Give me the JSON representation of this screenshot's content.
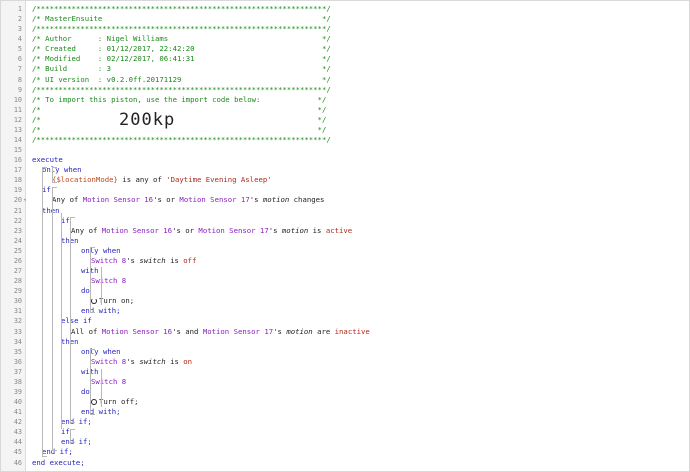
{
  "lines": [
    {
      "n": "1",
      "t": "/******************************************************************/"
    },
    {
      "n": "2",
      "t": "/* MasterEnsuite                                                  */"
    },
    {
      "n": "3",
      "t": "/******************************************************************/"
    },
    {
      "n": "4",
      "t": "/* Author      : Nigel Williams                                   */"
    },
    {
      "n": "5",
      "t": "/* Created     : 01/12/2017, 22:42:20                             */"
    },
    {
      "n": "6",
      "t": "/* Modified    : 02/12/2017, 06:41:31                             */"
    },
    {
      "n": "7",
      "t": "/* Build       : 3                                                */"
    },
    {
      "n": "8",
      "t": "/* UI version  : v0.2.0ff.20171129                                */"
    },
    {
      "n": "9",
      "t": "/******************************************************************/"
    },
    {
      "n": "10",
      "t": "/* To import this piston, use the import code below:             */"
    },
    {
      "n": "11",
      "t": "/*                                                               */"
    },
    {
      "n": "12",
      "t": "/*                                                               */"
    },
    {
      "n": "13",
      "t": "/*                                                               */"
    },
    {
      "n": "14",
      "t": "/******************************************************************/"
    }
  ],
  "import_code": "200kp",
  "code": {
    "l16_execute": "execute",
    "l17_only_when": "only when",
    "l18_location": "{$locationMode}",
    "l18_is_any_of": " is any of ",
    "l18_value": "'Daytime Evening Asleep'",
    "l19_if": "if",
    "l20_any_of": "Any of ",
    "l20_dev1": "Motion Sensor 16",
    "l20_s_or": "'s or ",
    "l20_dev2": "Motion Sensor 17",
    "l20_s": "'s ",
    "l20_attr": "motion",
    "l20_changes": " changes",
    "l21_then": "then",
    "l22_if": "if",
    "l23_any_of": "Any of ",
    "l23_dev1": "Motion Sensor 16",
    "l23_s_or": "'s or ",
    "l23_dev2": "Motion Sensor 17",
    "l23_s": "'s ",
    "l23_attr": "motion",
    "l23_is": " is ",
    "l23_val": "active",
    "l24_then": "then",
    "l25_only_when": "only when",
    "l26_dev": "Switch 8",
    "l26_s": "'s ",
    "l26_attr": "switch",
    "l26_is": " is ",
    "l26_val": "off",
    "l27_with": "with",
    "l28_dev": "Switch 8",
    "l29_do": "do",
    "l30_action": "Turn on;",
    "l31_end_with": "end with;",
    "l32_else_if": "else if",
    "l33_all_of": "All of ",
    "l33_dev1": "Motion Sensor 16",
    "l33_s_and": "'s and ",
    "l33_dev2": "Motion Sensor 17",
    "l33_s": "'s ",
    "l33_attr": "motion",
    "l33_are": " are ",
    "l33_val": "inactive",
    "l34_then": "then",
    "l35_only_when": "only when",
    "l36_dev": "Switch 8",
    "l36_s": "'s ",
    "l36_attr": "switch",
    "l36_is": " is ",
    "l36_val": "on",
    "l37_with": "with",
    "l38_dev": "Switch 8",
    "l39_do": "do",
    "l40_action": "Turn off;",
    "l41_end_with": "end with;",
    "l42_end_if": "end if;",
    "l43_if": "if",
    "l44_end_if": "end if;",
    "l45_end_if": "end if;",
    "l46_end_execute": "end execute;"
  },
  "gutter_numbers": [
    "15",
    "16",
    "17",
    "18",
    "19",
    "20",
    "21",
    "22",
    "23",
    "24",
    "25",
    "26",
    "27",
    "28",
    "29",
    "30",
    "31",
    "32",
    "33",
    "34",
    "35",
    "36",
    "37",
    "38",
    "39",
    "40",
    "41",
    "42",
    "43",
    "44",
    "45",
    "46"
  ],
  "trigger_marker_line": "20",
  "trigger_marker": "⚡"
}
